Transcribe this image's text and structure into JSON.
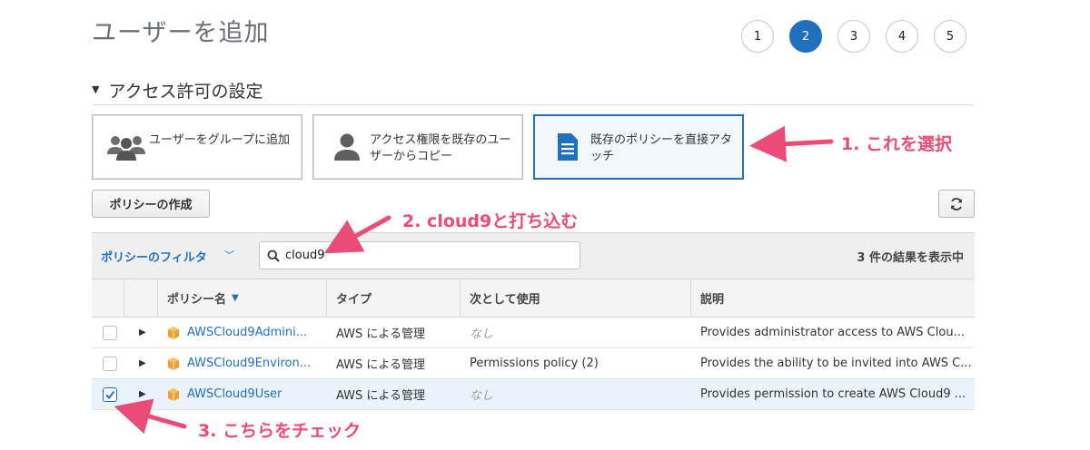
{
  "page": {
    "title": "ユーザーを追加"
  },
  "steps": [
    "1",
    "2",
    "3",
    "4",
    "5"
  ],
  "active_step": "2",
  "section": {
    "title": "アクセス許可の設定"
  },
  "options": [
    {
      "label": "ユーザーをグループに追加",
      "icon": "group-icon",
      "selected": false
    },
    {
      "label": "アクセス権限を既存のユーザーからコピー",
      "icon": "user-icon",
      "selected": false
    },
    {
      "label": "既存のポリシーを直接アタッチ",
      "icon": "document-icon",
      "selected": true
    }
  ],
  "buttons": {
    "create_policy": "ポリシーの作成",
    "refresh_icon": "refresh-icon"
  },
  "filter": {
    "label": "ポリシーのフィルタ",
    "search_value": "cloud9",
    "result_count": "3 件の結果を表示中"
  },
  "table": {
    "headers": [
      "ポリシー名",
      "タイプ",
      "次として使用",
      "説明"
    ],
    "rows": [
      {
        "name": "AWSCloud9Admini...",
        "type": "AWS による管理",
        "used_as": "なし",
        "used_muted": true,
        "description": "Provides administrator access to AWS Clou...",
        "checked": false
      },
      {
        "name": "AWSCloud9Environ...",
        "type": "AWS による管理",
        "used_as": "Permissions policy (2)",
        "used_muted": false,
        "description": "Provides the ability to be invited into AWS C...",
        "checked": false
      },
      {
        "name": "AWSCloud9User",
        "type": "AWS による管理",
        "used_as": "なし",
        "used_muted": true,
        "description": "Provides permission to create AWS Cloud9 ...",
        "checked": true
      }
    ]
  },
  "annotations": {
    "step1": "1. これを選択",
    "step2": "2. cloud9と打ち込む",
    "step3": "3. こちらをチェック"
  },
  "colors": {
    "accent": "#2070c0",
    "annotation": "#ea4b77",
    "policy_icon": "#f0a030"
  }
}
